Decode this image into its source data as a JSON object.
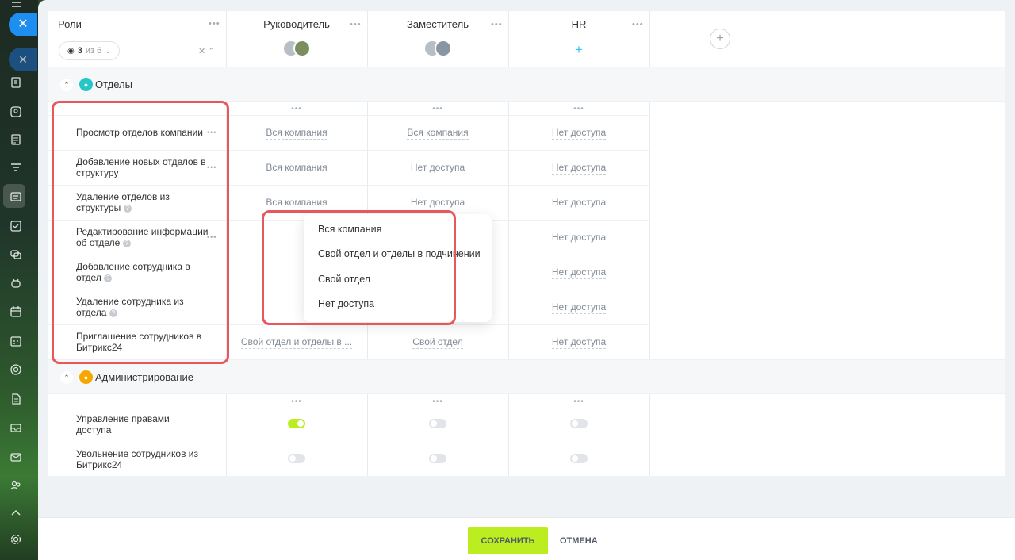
{
  "header": {
    "roles_label": "Роли",
    "viewer_count": "3",
    "viewer_of": "из 6",
    "columns": [
      {
        "title": "Руководитель"
      },
      {
        "title": "Заместитель"
      },
      {
        "title": "HR"
      }
    ]
  },
  "groups": [
    {
      "label": "Отделы",
      "rows": [
        {
          "label": "Просмотр отделов компании",
          "values": [
            "Вся компания",
            "Вся компания",
            "Нет доступа"
          ]
        },
        {
          "label": "Добавление новых отделов в структуру",
          "values": [
            "Вся компания",
            "Нет доступа",
            "Нет доступа"
          ]
        },
        {
          "label": "Удаление отделов из структуры",
          "values": [
            "Вся компания",
            "Нет доступа",
            "Нет доступа"
          ]
        },
        {
          "label": "Редактирование информации об отделе",
          "values": [
            "",
            "",
            "Нет доступа"
          ]
        },
        {
          "label": "Добавление сотрудника в отдел",
          "values": [
            "",
            "",
            "Нет доступа"
          ]
        },
        {
          "label": "Удаление сотрудника из отдела",
          "values": [
            "",
            "",
            "Нет доступа"
          ]
        },
        {
          "label": "Приглашение сотрудников в Битрикс24",
          "values": [
            "Свой отдел и отделы в ...",
            "Свой отдел",
            "Нет доступа"
          ]
        }
      ]
    },
    {
      "label": "Администрирование",
      "rows": [
        {
          "label": "Управление правами доступа",
          "toggles": [
            true,
            false,
            false
          ]
        },
        {
          "label": "Увольнение сотрудников из Битрикс24",
          "toggles": [
            false,
            false,
            false
          ]
        }
      ]
    }
  ],
  "dropdown": {
    "options": [
      "Вся компания",
      "Свой отдел и отделы в подчинении",
      "Свой отдел",
      "Нет доступа"
    ]
  },
  "footer": {
    "save_label": "СОХРАНИТЬ",
    "cancel_label": "ОТМЕНА"
  },
  "colors": {
    "accent_green": "#bbed21",
    "highlight_red": "#e8575b",
    "blue": "#1f8ef1",
    "departments_icon": "#26c6c6",
    "admin_icon": "#f7a700"
  }
}
